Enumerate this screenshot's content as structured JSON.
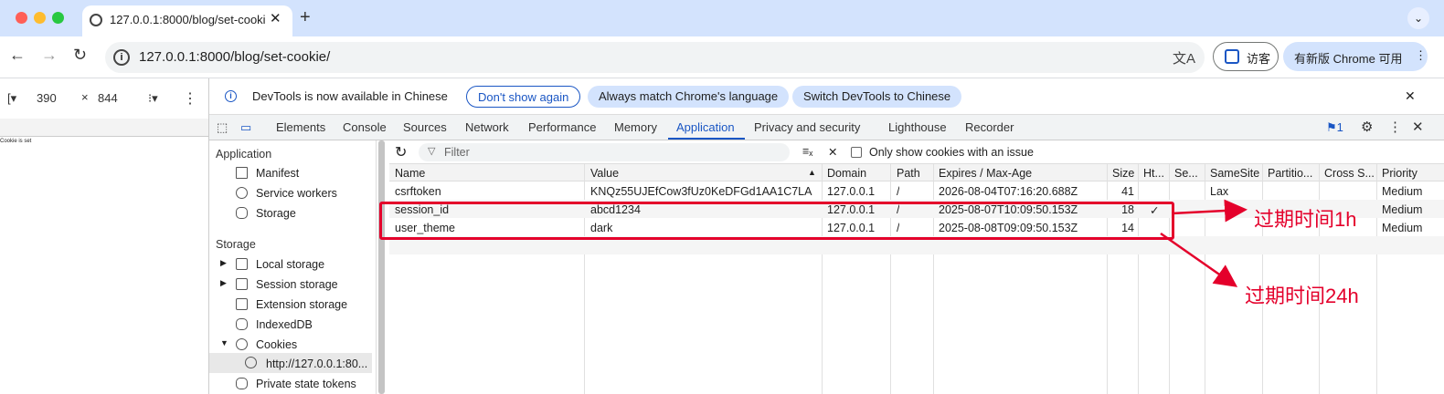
{
  "browser": {
    "tab_title": "127.0.0.1:8000/blog/set-cookie/",
    "tab_close": "✕",
    "new_tab": "+",
    "tab_menu": "⌄",
    "url": "127.0.0.1:8000/blog/set-cookie/",
    "guest_label": "访客",
    "update_label": "有新版 Chrome 可用",
    "colors": {
      "tabstrip": "#d3e3fd",
      "close": "#ff5f57",
      "min": "#febc2e",
      "max": "#28c840"
    }
  },
  "device_toolbar": {
    "width": "390",
    "times": "×",
    "height": "844"
  },
  "viewport": {
    "text": "Cookie is set"
  },
  "devtools": {
    "infobar": {
      "message": "DevTools is now available in Chinese",
      "dont_show": "Don't show again",
      "always_match": "Always match Chrome's language",
      "switch": "Switch DevTools to Chinese",
      "close": "✕"
    },
    "tabs": [
      "Elements",
      "Console",
      "Sources",
      "Network",
      "Performance",
      "Memory",
      "Application",
      "Privacy and security",
      "Lighthouse",
      "Recorder"
    ],
    "active_tab": "Application",
    "issues_count": "1",
    "sidebar": {
      "application_header": "Application",
      "application_items": [
        "Manifest",
        "Service workers",
        "Storage"
      ],
      "storage_header": "Storage",
      "storage_items": [
        "Local storage",
        "Session storage",
        "Extension storage",
        "IndexedDB",
        "Cookies"
      ],
      "cookie_origin": "http://127.0.0.1:80...",
      "private_tokens": "Private state tokens"
    },
    "filter": {
      "placeholder": "Filter",
      "only_issues_label": "Only show cookies with an issue"
    },
    "cookie_table": {
      "columns": [
        "Name",
        "Value",
        "Domain",
        "Path",
        "Expires / Max-Age",
        "Size",
        "Ht...",
        "Se...",
        "SameSite",
        "Partitio...",
        "Cross S...",
        "Priority"
      ],
      "sort_indicator": "▲",
      "rows": [
        {
          "name": "csrftoken",
          "value": "KNQz55UJEfCow3fUz0KeDFGd1AA1C7LA",
          "domain": "127.0.0.1",
          "path": "/",
          "expires": "2026-08-04T07:16:20.688Z",
          "size": "41",
          "httponly": "",
          "secure": "",
          "samesite": "Lax",
          "partition": "",
          "cross": "",
          "priority": "Medium"
        },
        {
          "name": "session_id",
          "value": "abcd1234",
          "domain": "127.0.0.1",
          "path": "/",
          "expires": "2025-08-07T10:09:50.153Z",
          "size": "18",
          "httponly": "✓",
          "secure": "",
          "samesite": "",
          "partition": "",
          "cross": "",
          "priority": "Medium"
        },
        {
          "name": "user_theme",
          "value": "dark",
          "domain": "127.0.0.1",
          "path": "/",
          "expires": "2025-08-08T09:09:50.153Z",
          "size": "14",
          "httponly": "",
          "secure": "",
          "samesite": "",
          "partition": "",
          "cross": "",
          "priority": "Medium"
        }
      ]
    }
  },
  "annotations": {
    "label_1h": "过期时间1h",
    "label_24h": "过期时间24h",
    "color": "#e4002b"
  }
}
